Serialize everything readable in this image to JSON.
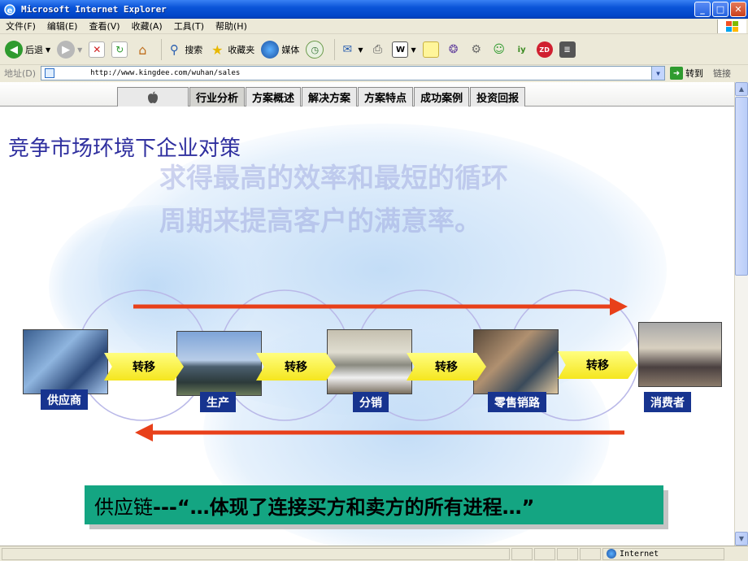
{
  "window": {
    "title": "Microsoft Internet Explorer",
    "minimize": "_",
    "maximize": "□",
    "close": "✕"
  },
  "menubar": {
    "items": [
      "文件(F)",
      "编辑(E)",
      "查看(V)",
      "收藏(A)",
      "工具(T)",
      "帮助(H)"
    ]
  },
  "toolbar": {
    "back": "后退",
    "search": "搜索",
    "favorites": "收藏夹",
    "media": "媒体"
  },
  "address": {
    "label": "地址(D)",
    "url": "http://www.kingdee.com/wuhan/sales",
    "go": "转到",
    "links": "链接"
  },
  "tabs": [
    "行业分析",
    "方案概述",
    "解决方案",
    "方案特点",
    "成功案例",
    "投资回报"
  ],
  "slide": {
    "title": "竞争市场环境下企业对策",
    "watermark_line1": "求得最高的效率和最短的循环",
    "watermark_line2": "周期来提高客户的满意率。",
    "stages": [
      "供应商",
      "生产",
      "分销",
      "零售销路",
      "消费者"
    ],
    "transfer": "转移",
    "quote_prefix": "供应链",
    "quote_body": "---“…体现了连接买方和卖方的所有进程…”"
  },
  "statusbar": {
    "zone": "Internet"
  },
  "colors": {
    "accent_arrow": "#e8401a",
    "label_bg": "#17348f",
    "quote_bg": "#14a582",
    "title": "#2f2f9f"
  }
}
